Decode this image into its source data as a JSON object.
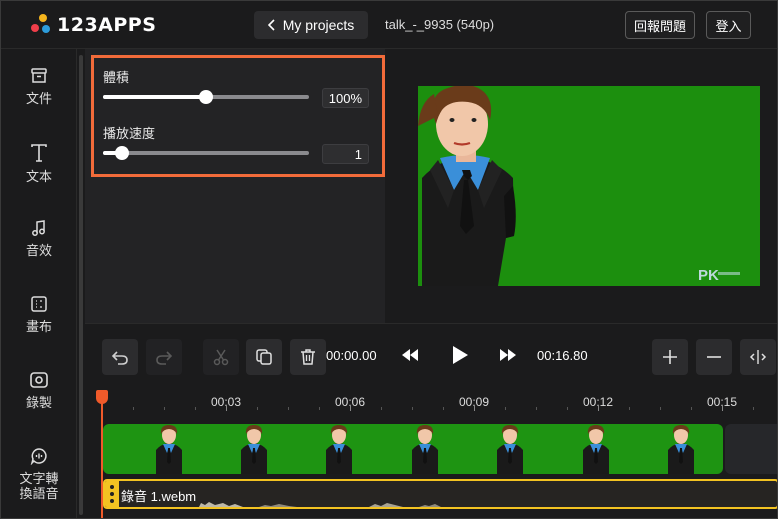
{
  "header": {
    "logo_text": "123APPS",
    "my_projects_label": "My projects",
    "project_name": "talk_-_9935 (540p)",
    "feedback_label": "回報問題",
    "login_label": "登入"
  },
  "sidebar": {
    "items": [
      {
        "label": "文件",
        "icon": "file-icon"
      },
      {
        "label": "文本",
        "icon": "text-icon"
      },
      {
        "label": "音效",
        "icon": "music-note-icon"
      },
      {
        "label": "畫布",
        "icon": "canvas-icon"
      },
      {
        "label": "錄製",
        "icon": "record-icon"
      },
      {
        "label": "文字轉\n換語音",
        "icon": "text-to-speech-icon"
      }
    ]
  },
  "settings": {
    "volume_label": "體積",
    "volume_value": "100%",
    "volume_level": 0.5,
    "speed_label": "播放速度",
    "speed_value": "1",
    "speed_level": 0.09
  },
  "preview": {
    "watermark": "PK"
  },
  "toolbar": {
    "current_time": "00:00.00",
    "total_time": "00:16.80"
  },
  "timeline": {
    "ticks": [
      "00:03",
      "00:06",
      "00:09",
      "00:12",
      "00:15"
    ],
    "audio_clip_name": "錄音 1.webm"
  },
  "colors": {
    "accent_orange": "#f26b3a",
    "video_green": "#1e9412",
    "audio_yellow": "#f3c322"
  }
}
